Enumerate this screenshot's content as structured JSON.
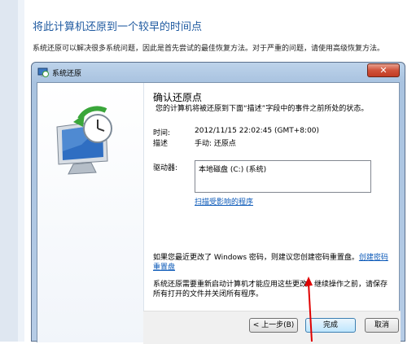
{
  "page": {
    "heading": "将此计算机还原到一个较早的时间点",
    "intro": "系统还原可以解决很多系统问题，因此是首先尝试的最佳恢复方法。对于严重的问题，请使用高级恢复方法。"
  },
  "dialog": {
    "title": "系统还原",
    "close_glyph": "✕",
    "confirm_title": "确认还原点",
    "confirm_desc": "您的计算机将被还原到下面“描述”字段中的事件之前所处的状态。",
    "time_label": "时间:",
    "time_value": "2012/11/15 22:02:45 (GMT+8:00)",
    "desc_label": "描述",
    "desc_value": "手动: 还原点",
    "drive_label": "驱动器:",
    "drive_item": "本地磁盘 (C:) (系统)",
    "scan_link": "扫描受影响的程序",
    "password_text": "如果您最近更改了 Windows 密码，则建议您创建密码重置盘。",
    "password_link": "创建密码重置盘",
    "restart_text": "系统还原需要重新启动计算机才能应用这些更改。继续操作之前，请保存所有打开的文件并关闭所有程序。",
    "buttons": {
      "back": "< 上一步(B)",
      "finish": "完成",
      "cancel": "取消"
    }
  },
  "colors": {
    "heading": "#1f5aa0",
    "link": "#0b59b8",
    "arrow": "#e00000"
  }
}
